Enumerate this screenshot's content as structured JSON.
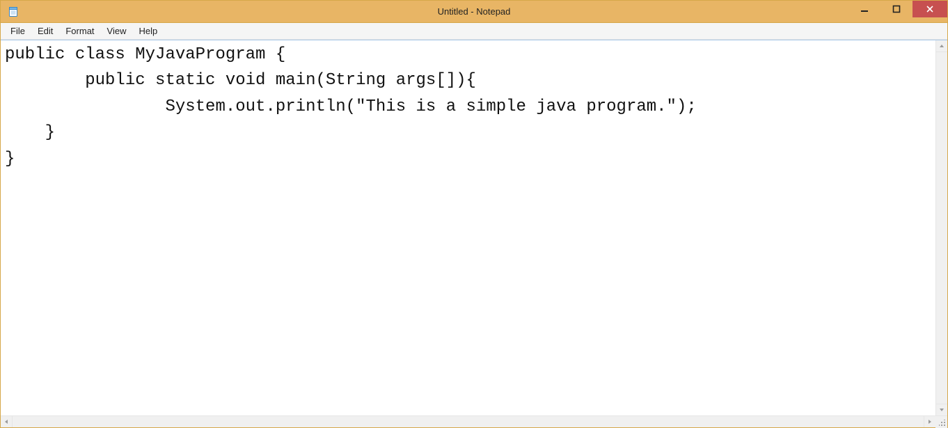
{
  "titlebar": {
    "title": "Untitled - Notepad"
  },
  "menu": {
    "items": [
      "File",
      "Edit",
      "Format",
      "View",
      "Help"
    ]
  },
  "editor": {
    "content": "public class MyJavaProgram {\n\tpublic static void main(String args[]){\n\t\tSystem.out.println(\"This is a simple java program.\");\n    }\n}\n"
  }
}
